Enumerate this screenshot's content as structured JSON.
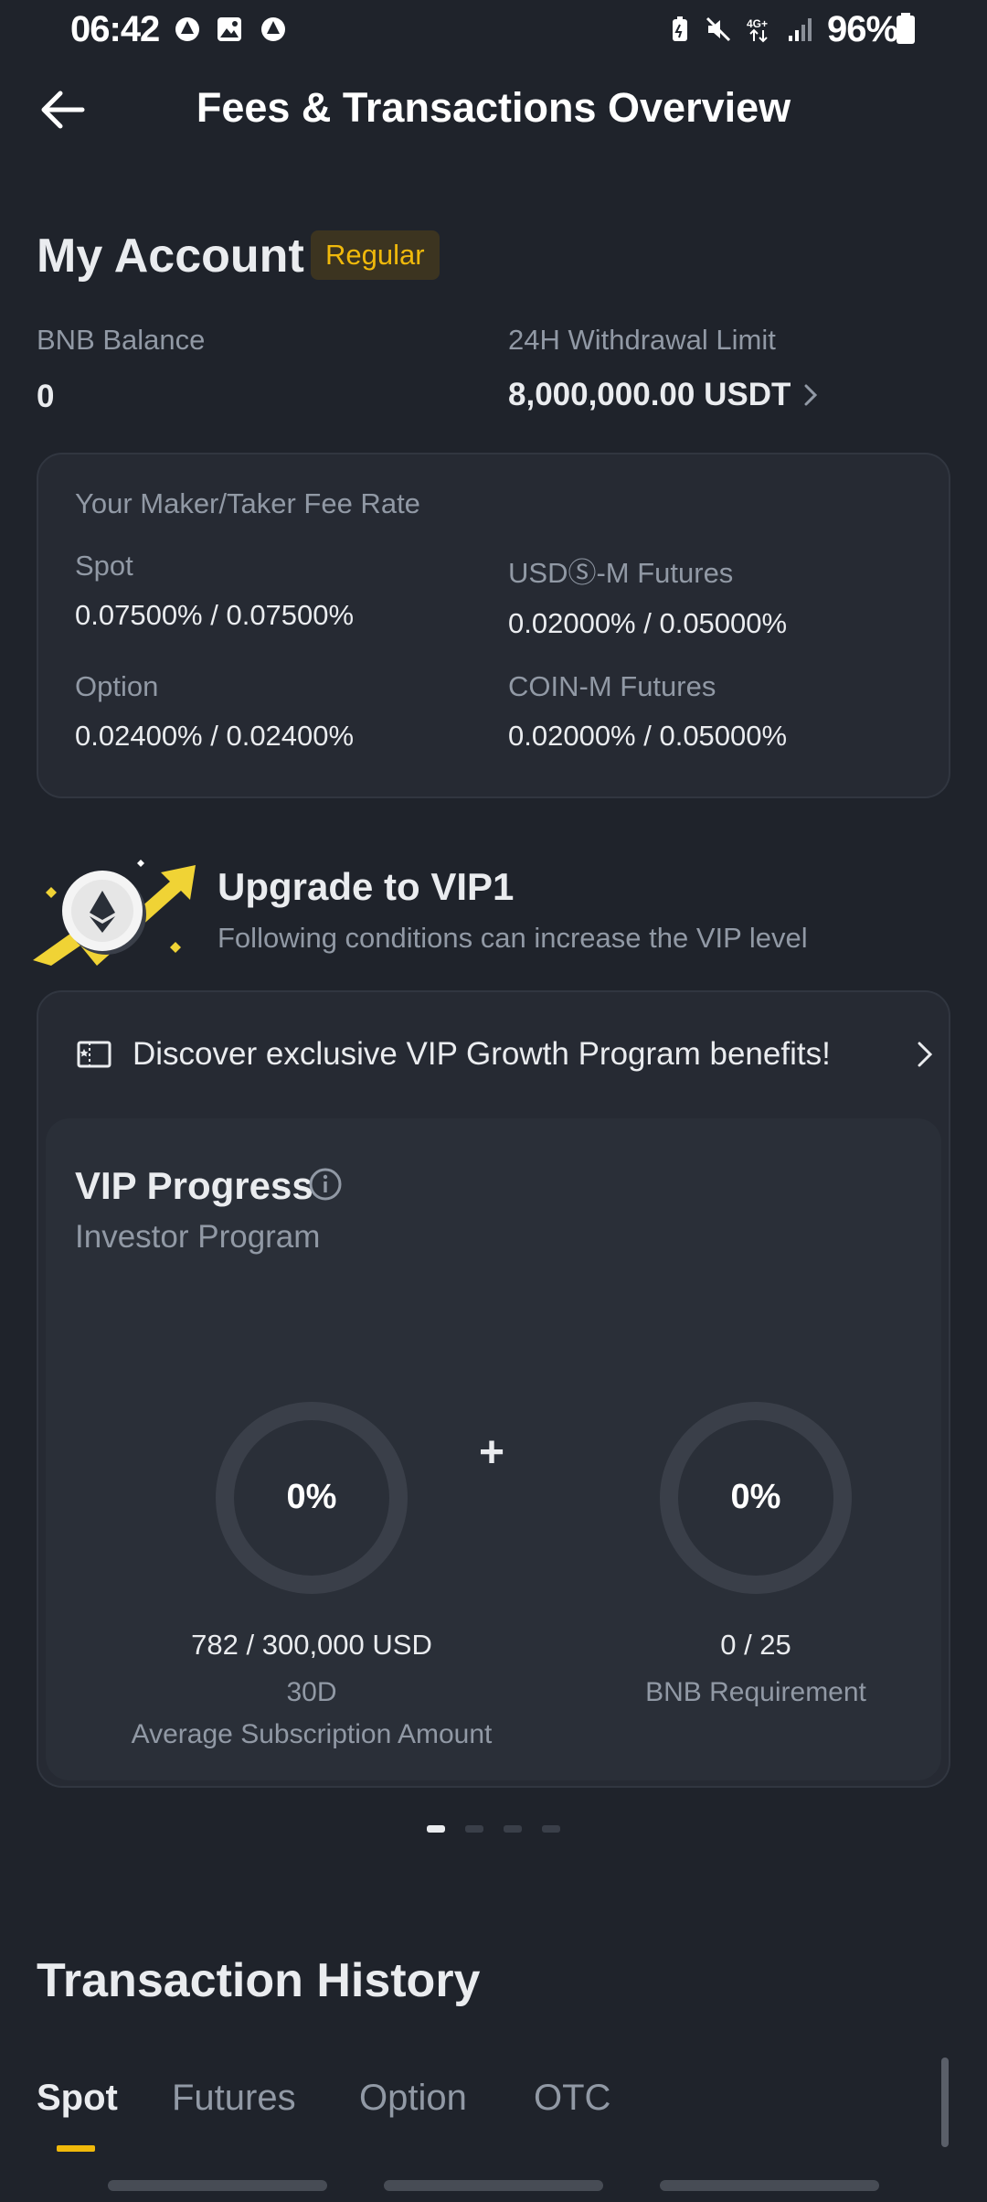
{
  "status_bar": {
    "time": "06:42",
    "battery": "96%",
    "left_icons": [
      "notification-icon",
      "gallery-icon",
      "notification-icon"
    ],
    "right_icons": [
      "battery-saver-icon",
      "mute-icon",
      "4g-data-icon",
      "signal-icon",
      "battery-icon"
    ]
  },
  "header": {
    "title": "Fees & Transactions Overview",
    "back_icon": "arrow-left-icon"
  },
  "account": {
    "title": "My Account",
    "badge": "Regular",
    "bnb_label": "BNB Balance",
    "bnb_value": "0",
    "withdrawal_label": "24H Withdrawal Limit",
    "withdrawal_value": "8,000,000.00 USDT"
  },
  "fee_rates": {
    "title": "Your Maker/Taker Fee Rate",
    "items": [
      {
        "label": "Spot",
        "value": "0.07500% / 0.07500%"
      },
      {
        "label": "USDⓈ-M Futures",
        "value": "0.02000% / 0.05000%"
      },
      {
        "label": "Option",
        "value": "0.02400% / 0.02400%"
      },
      {
        "label": "COIN-M Futures",
        "value": "0.02000% / 0.05000%"
      }
    ]
  },
  "upgrade": {
    "title": "Upgrade to VIP1",
    "subtitle": "Following conditions can increase the VIP level"
  },
  "vip_card": {
    "discover_text": "Discover exclusive VIP Growth Program benefits!",
    "progress_title": "VIP Progress",
    "program_label": "Investor Program",
    "plus": "+",
    "left_ring": {
      "percent": "0%",
      "fill": 0,
      "amount": "782 / 300,000 USD",
      "period": "30D",
      "caption": "Average Subscription Amount"
    },
    "right_ring": {
      "percent": "0%",
      "fill": 0,
      "amount": "0 / 25",
      "caption": "BNB Requirement"
    }
  },
  "pager": {
    "count": 4,
    "active": 0
  },
  "transaction_history": {
    "title": "Transaction History",
    "tabs": [
      "Spot",
      "Futures",
      "Option",
      "OTC"
    ],
    "active_tab": "Spot"
  },
  "colors": {
    "background": "#1f232b",
    "card": "#262a33",
    "accent": "#f0b90b",
    "muted_text": "#9199a5"
  }
}
